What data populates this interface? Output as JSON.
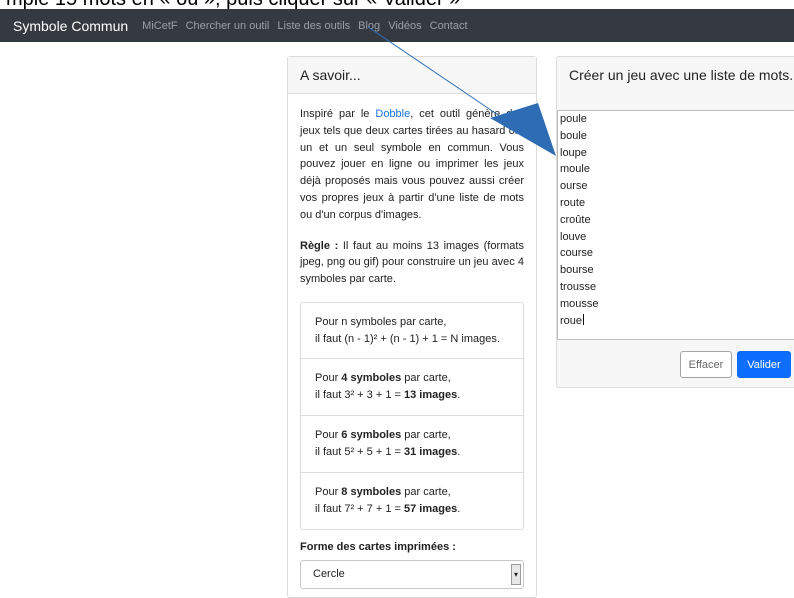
{
  "caption": "mple 15 mots en « ou », puis cliquer sur « Valider »",
  "navbar": {
    "brand": "Symbole Commun",
    "links": [
      "MiCetF",
      "Chercher un outil",
      "Liste des outils",
      "Blog",
      "Vidéos",
      "Contact"
    ]
  },
  "left_panel": {
    "title": "A savoir...",
    "intro_before_link": "Inspiré par le ",
    "intro_link": "Dobble",
    "intro_after_link": ", cet outil génère des jeux tels que deux cartes tirées au hasard ont un et un seul symbole en commun. Vous pouvez jouer en ligne ou imprimer les jeux déjà proposés mais vous pouvez aussi créer vos propres jeux à partir d'une liste de mots ou d'un corpus d'images.",
    "rule_label": "Règle :",
    "rule_text": " Il faut au moins 13 images (formats jpeg, png ou gif) pour construire un jeu avec 4 symboles par carte.",
    "formula_general_line1": "Pour n symboles par carte,",
    "formula_general_line2": "il faut (n - 1)² + (n - 1) + 1 = N images.",
    "formulas": [
      {
        "prefix": "Pour ",
        "bold": "4 symboles",
        "suffix": " par carte,",
        "line2_prefix": "il faut 3² + 3 + 1 = ",
        "line2_bold": "13 images",
        "line2_suffix": "."
      },
      {
        "prefix": "Pour ",
        "bold": "6 symboles",
        "suffix": " par carte,",
        "line2_prefix": "il faut 5² + 5 + 1 = ",
        "line2_bold": "31 images",
        "line2_suffix": "."
      },
      {
        "prefix": "Pour ",
        "bold": "8 symboles",
        "suffix": " par carte,",
        "line2_prefix": "il faut 7² + 7 + 1 = ",
        "line2_bold": "57 images",
        "line2_suffix": "."
      }
    ],
    "forme_label": "Forme des cartes imprimées :",
    "forme_selected": "Cercle"
  },
  "right_panel": {
    "title": "Créer un jeu avec une liste de mots.",
    "words": [
      "poule",
      "boule",
      "loupe",
      "moule",
      "ourse",
      "route",
      "croûte",
      "louve",
      "course",
      "bourse",
      "trousse",
      "mousse",
      "roue"
    ],
    "clear_label": "Effacer",
    "submit_label": "Valider"
  },
  "colors": {
    "navbar_bg": "#343a40",
    "link": "#1a73e8",
    "primary_button": "#0d6efd",
    "annotation_arrow": "#2e6db4"
  }
}
